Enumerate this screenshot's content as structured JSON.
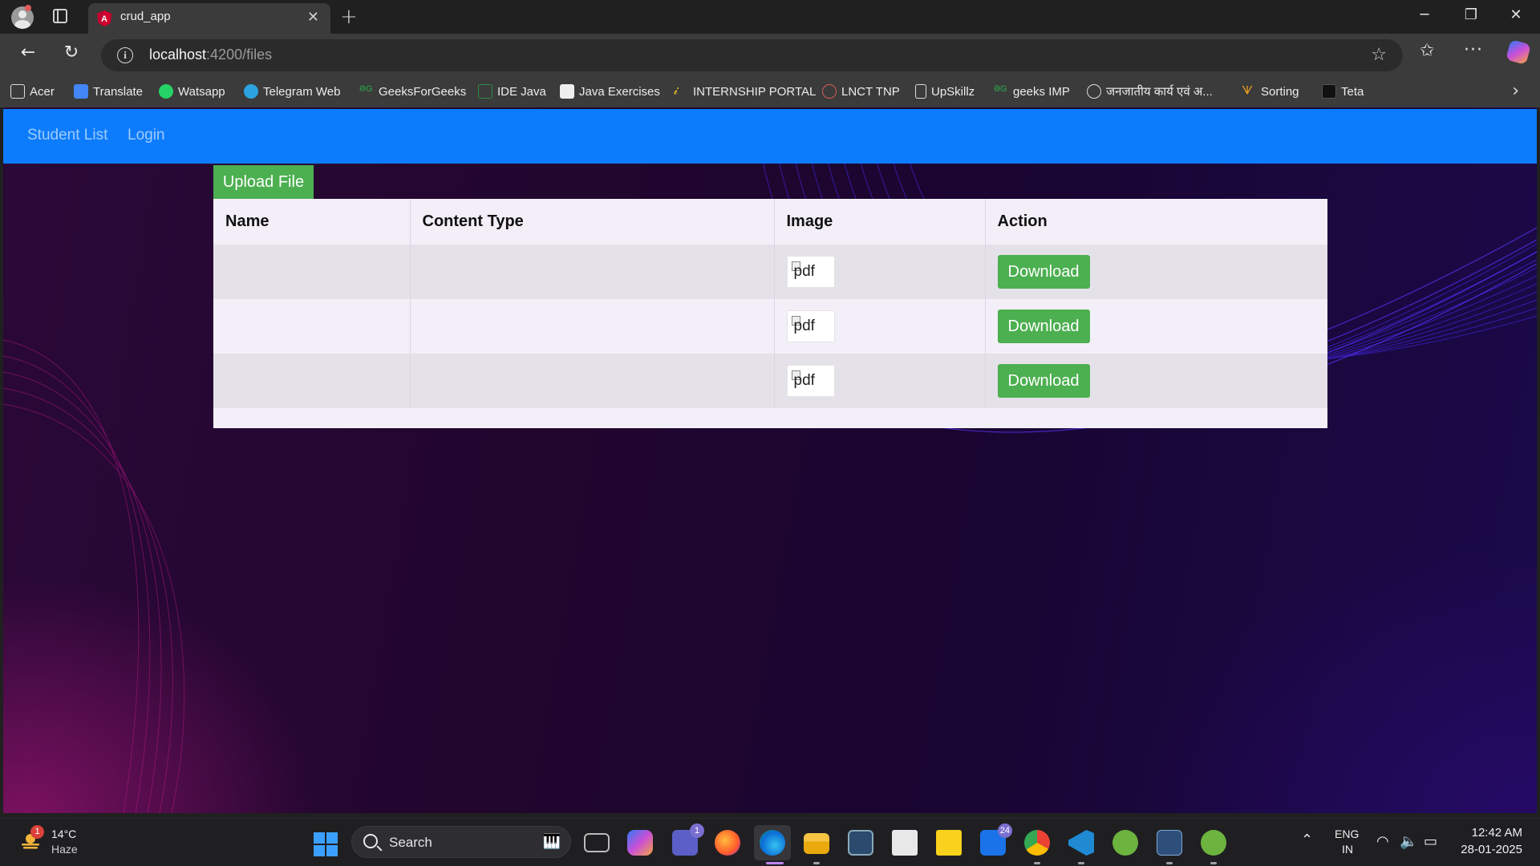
{
  "browser": {
    "tab_title": "crud_app",
    "url_host": "localhost",
    "url_path": ":4200/files",
    "bookmarks": [
      "Acer",
      "Translate",
      "Watsapp",
      "Telegram Web",
      "GeeksForGeeks",
      "IDE Java",
      "Java Exercises",
      "INTERNSHIP PORTAL",
      "LNCT TNP",
      "UpSkillz",
      "geeks IMP",
      "जनजातीय कार्य एवं अ...",
      "Sorting",
      "Teta"
    ]
  },
  "app": {
    "nav": [
      "Student List",
      "Login"
    ],
    "upload_label": "Upload File",
    "table": {
      "columns": [
        "Name",
        "Content Type",
        "Image",
        "Action"
      ],
      "rows": [
        {
          "name": "",
          "content_type": "",
          "image_alt": "pdf",
          "action": "Download"
        },
        {
          "name": "",
          "content_type": "",
          "image_alt": "pdf",
          "action": "Download"
        },
        {
          "name": "",
          "content_type": "",
          "image_alt": "pdf",
          "action": "Download"
        }
      ]
    },
    "colors": {
      "appbar": "#0d7cfc",
      "button": "#4caf50"
    }
  },
  "taskbar": {
    "weather_badge": "1",
    "temperature": "14°C",
    "condition": "Haze",
    "search_placeholder": "Search",
    "teams_badge": "1",
    "mail_badge": "24",
    "lang_line1": "ENG",
    "lang_line2": "IN",
    "time": "12:42 AM",
    "date": "28-01-2025"
  }
}
